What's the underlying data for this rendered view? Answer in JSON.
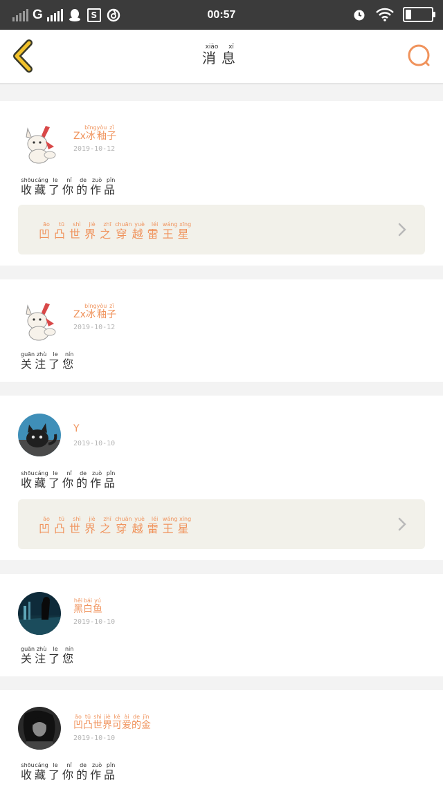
{
  "status_bar": {
    "network": "G",
    "time": "00:57",
    "icons": [
      "signal-weak-icon",
      "signal-icon",
      "qq-icon",
      "s-box-icon",
      "netease-icon",
      "alarm-icon",
      "wifi-icon",
      "battery-icon"
    ]
  },
  "header": {
    "title": [
      {
        "c": "消",
        "p": "xiāo"
      },
      {
        "c": "息",
        "p": "xī"
      }
    ],
    "back_icon": "chevron-left-icon",
    "search_icon": "search-icon"
  },
  "colors": {
    "accent": "#f0935c",
    "back_yellow": "#f2c22b",
    "card_link_bg": "#f2f1ea",
    "status_bar": "#3b3b3b"
  },
  "messages": [
    {
      "user_prefix": "Zx",
      "user": [
        {
          "c": "冰",
          "p": "bīng"
        },
        {
          "c": "釉",
          "p": "yòu"
        },
        {
          "c": "子",
          "p": "zǐ"
        }
      ],
      "date": "2019-10-12",
      "action": [
        {
          "c": "收",
          "p": "shōu"
        },
        {
          "c": "藏",
          "p": "cáng"
        },
        {
          "c": "了",
          "p": "le"
        },
        {
          "c": "你",
          "p": "nǐ"
        },
        {
          "c": "的",
          "p": "de"
        },
        {
          "c": "作",
          "p": "zuò"
        },
        {
          "c": "品",
          "p": "pǐn"
        }
      ],
      "work": [
        {
          "c": "凹",
          "p": "āo"
        },
        {
          "c": "凸",
          "p": "tū"
        },
        {
          "c": "世",
          "p": "shì"
        },
        {
          "c": "界",
          "p": "jiè"
        },
        {
          "c": "之",
          "p": "zhī"
        },
        {
          "c": "穿",
          "p": "chuān"
        },
        {
          "c": "越",
          "p": "yuè"
        },
        {
          "c": "雷",
          "p": "léi"
        },
        {
          "c": "王",
          "p": "wáng"
        },
        {
          "c": "星",
          "p": "xīng"
        }
      ],
      "avatar": "pikachu-fox-avatar"
    },
    {
      "user_prefix": "Zx",
      "user": [
        {
          "c": "冰",
          "p": "bīng"
        },
        {
          "c": "釉",
          "p": "yòu"
        },
        {
          "c": "子",
          "p": "zǐ"
        }
      ],
      "date": "2019-10-12",
      "action": [
        {
          "c": "关",
          "p": "guān"
        },
        {
          "c": "注",
          "p": "zhù"
        },
        {
          "c": "了",
          "p": "le"
        },
        {
          "c": "您",
          "p": "nín"
        }
      ],
      "work": null,
      "avatar": "pikachu-fox-avatar"
    },
    {
      "user_prefix": "Y",
      "user": [],
      "date": "2019-10-10",
      "action": [
        {
          "c": "收",
          "p": "shōu"
        },
        {
          "c": "藏",
          "p": "cáng"
        },
        {
          "c": "了",
          "p": "le"
        },
        {
          "c": "你",
          "p": "nǐ"
        },
        {
          "c": "的",
          "p": "de"
        },
        {
          "c": "作",
          "p": "zuò"
        },
        {
          "c": "品",
          "p": "pǐn"
        }
      ],
      "work": [
        {
          "c": "凹",
          "p": "āo"
        },
        {
          "c": "凸",
          "p": "tū"
        },
        {
          "c": "世",
          "p": "shì"
        },
        {
          "c": "界",
          "p": "jiè"
        },
        {
          "c": "之",
          "p": "zhī"
        },
        {
          "c": "穿",
          "p": "chuān"
        },
        {
          "c": "越",
          "p": "yuè"
        },
        {
          "c": "雷",
          "p": "léi"
        },
        {
          "c": "王",
          "p": "wáng"
        },
        {
          "c": "星",
          "p": "xīng"
        }
      ],
      "avatar": "black-cat-avatar"
    },
    {
      "user_prefix": "",
      "user": [
        {
          "c": "黑",
          "p": "hēi"
        },
        {
          "c": "白",
          "p": "bái"
        },
        {
          "c": "鱼",
          "p": "yú"
        }
      ],
      "date": "2019-10-10",
      "action": [
        {
          "c": "关",
          "p": "guān"
        },
        {
          "c": "注",
          "p": "zhù"
        },
        {
          "c": "了",
          "p": "le"
        },
        {
          "c": "您",
          "p": "nín"
        }
      ],
      "work": null,
      "avatar": "anime-scene-avatar"
    },
    {
      "user_prefix": "",
      "user": [
        {
          "c": "凹",
          "p": "āo"
        },
        {
          "c": "凸",
          "p": "tū"
        },
        {
          "c": "世",
          "p": "shì"
        },
        {
          "c": "界",
          "p": "jiè"
        },
        {
          "c": "可",
          "p": "kě"
        },
        {
          "c": "爱",
          "p": "ài"
        },
        {
          "c": "的",
          "p": "de"
        },
        {
          "c": "金",
          "p": "jīn"
        }
      ],
      "date": "2019-10-10",
      "action": [
        {
          "c": "收",
          "p": "shōu"
        },
        {
          "c": "藏",
          "p": "cáng"
        },
        {
          "c": "了",
          "p": "le"
        },
        {
          "c": "你",
          "p": "nǐ"
        },
        {
          "c": "的",
          "p": "de"
        },
        {
          "c": "作",
          "p": "zuò"
        },
        {
          "c": "品",
          "p": "pǐn"
        }
      ],
      "work": null,
      "avatar": "dark-anime-avatar"
    }
  ]
}
